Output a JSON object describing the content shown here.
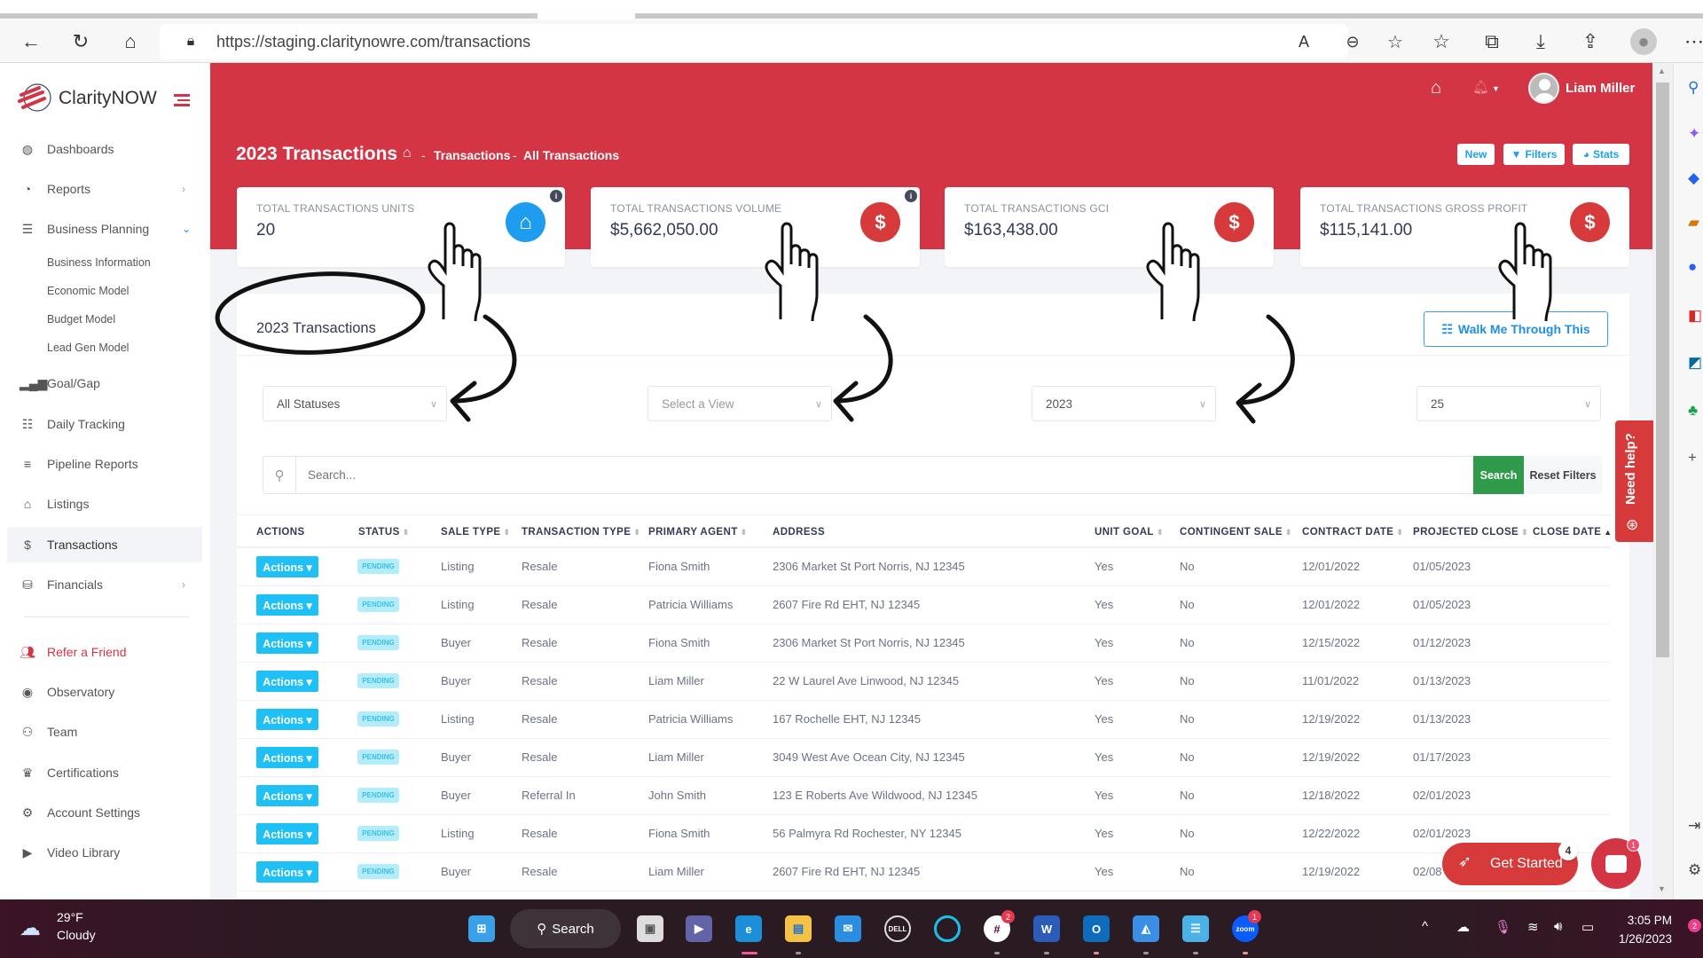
{
  "browser": {
    "url": "https://staging.claritynowre.com/transactions",
    "icons": [
      "back-icon",
      "refresh-icon",
      "home-icon",
      "lock-icon",
      "read-aloud-icon",
      "zoom-out-icon",
      "add-favorite-icon",
      "favorites-icon",
      "collections-icon",
      "downloads-icon",
      "share-icon",
      "profile-icon",
      "more-icon"
    ]
  },
  "sidebar": {
    "logo": "ClarityNOW",
    "items": [
      {
        "label": "Dashboards",
        "icon": "dashboard-icon"
      },
      {
        "label": "Reports",
        "icon": "pie-chart-icon"
      },
      {
        "label": "Business Planning",
        "icon": "list-check-icon"
      },
      {
        "label": "Business Information"
      },
      {
        "label": "Economic Model"
      },
      {
        "label": "Budget Model"
      },
      {
        "label": "Lead Gen Model"
      },
      {
        "label": "Goal/Gap",
        "icon": "bar-chart-icon"
      },
      {
        "label": "Daily Tracking",
        "icon": "list-icon"
      },
      {
        "label": "Pipeline Reports",
        "icon": "lines-icon"
      },
      {
        "label": "Listings",
        "icon": "house-icon"
      },
      {
        "label": "Transactions",
        "icon": "dollar-icon"
      },
      {
        "label": "Financials",
        "icon": "coins-icon"
      },
      {
        "label": "Refer a Friend",
        "icon": "users-icon"
      },
      {
        "label": "Observatory",
        "icon": "eye-icon"
      },
      {
        "label": "Team",
        "icon": "team-icon"
      },
      {
        "label": "Certifications",
        "icon": "crown-icon"
      },
      {
        "label": "Account Settings",
        "icon": "gear-icon"
      },
      {
        "label": "Video Library",
        "icon": "play-icon"
      }
    ]
  },
  "header": {
    "user_name": "Liam Miller",
    "page_title": "2023 Transactions",
    "breadcrumb": [
      "Transactions",
      "All Transactions"
    ],
    "buttons": {
      "new": "New",
      "filters": "Filters",
      "stats": "Stats"
    }
  },
  "cards": [
    {
      "title": "TOTAL TRANSACTIONS UNITS",
      "value": "20",
      "icon": "house-icon",
      "color": "#1e9cf0"
    },
    {
      "title": "TOTAL TRANSACTIONS VOLUME",
      "value": "$5,662,050.00",
      "icon": "dollar-icon",
      "color": "#d63a3a"
    },
    {
      "title": "TOTAL TRANSACTIONS GCI",
      "value": "$163,438.00",
      "icon": "dollar-icon",
      "color": "#d63a3a"
    },
    {
      "title": "TOTAL TRANSACTIONS GROSS PROFIT",
      "value": "$115,141.00",
      "icon": "dollar-icon",
      "color": "#d63a3a"
    }
  ],
  "panel": {
    "title": "2023 Transactions",
    "walk_me": "Walk Me Through This",
    "filters": {
      "status": "All Statuses",
      "view_placeholder": "Select a View",
      "year": "2023",
      "per_page": "25"
    },
    "search_placeholder": "Search...",
    "search_button": "Search",
    "reset_button": "Reset Filters"
  },
  "table": {
    "columns": [
      "ACTIONS",
      "STATUS",
      "SALE TYPE",
      "TRANSACTION TYPE",
      "PRIMARY AGENT",
      "ADDRESS",
      "UNIT GOAL",
      "CONTINGENT SALE",
      "CONTRACT DATE",
      "PROJECTED CLOSE",
      "CLOSE DATE"
    ],
    "sort_marks": [
      "",
      "⬍",
      "⬍",
      "⬍",
      "⬍",
      "",
      "⬍",
      "⬍",
      "⬍",
      "⬍",
      "▲"
    ],
    "action_label": "Actions ▾",
    "rows": [
      {
        "status": "PENDING",
        "sale_type": "Listing",
        "transaction_type": "Resale",
        "agent": "Fiona Smith",
        "address": "2306 Market St Port Norris, NJ 12345",
        "unit_goal": "Yes",
        "contingent": "No",
        "contract_date": "12/01/2022",
        "projected_close": "01/05/2023",
        "close_date": ""
      },
      {
        "status": "PENDING",
        "sale_type": "Listing",
        "transaction_type": "Resale",
        "agent": "Patricia Williams",
        "address": "2607 Fire Rd EHT, NJ 12345",
        "unit_goal": "Yes",
        "contingent": "No",
        "contract_date": "12/01/2022",
        "projected_close": "01/05/2023",
        "close_date": ""
      },
      {
        "status": "PENDING",
        "sale_type": "Buyer",
        "transaction_type": "Resale",
        "agent": "Fiona Smith",
        "address": "2306 Market St Port Norris, NJ 12345",
        "unit_goal": "Yes",
        "contingent": "No",
        "contract_date": "12/15/2022",
        "projected_close": "01/12/2023",
        "close_date": ""
      },
      {
        "status": "PENDING",
        "sale_type": "Buyer",
        "transaction_type": "Resale",
        "agent": "Liam Miller",
        "address": "22 W Laurel Ave Linwood, NJ 12345",
        "unit_goal": "Yes",
        "contingent": "No",
        "contract_date": "11/01/2022",
        "projected_close": "01/13/2023",
        "close_date": ""
      },
      {
        "status": "PENDING",
        "sale_type": "Listing",
        "transaction_type": "Resale",
        "agent": "Patricia Williams",
        "address": "167 Rochelle EHT, NJ 12345",
        "unit_goal": "Yes",
        "contingent": "No",
        "contract_date": "12/19/2022",
        "projected_close": "01/13/2023",
        "close_date": ""
      },
      {
        "status": "PENDING",
        "sale_type": "Buyer",
        "transaction_type": "Resale",
        "agent": "Liam Miller",
        "address": "3049 West Ave Ocean City, NJ 12345",
        "unit_goal": "Yes",
        "contingent": "No",
        "contract_date": "12/19/2022",
        "projected_close": "01/17/2023",
        "close_date": ""
      },
      {
        "status": "PENDING",
        "sale_type": "Buyer",
        "transaction_type": "Referral In",
        "agent": "John Smith",
        "address": "123 E Roberts Ave Wildwood, NJ 12345",
        "unit_goal": "Yes",
        "contingent": "No",
        "contract_date": "12/18/2022",
        "projected_close": "02/01/2023",
        "close_date": ""
      },
      {
        "status": "PENDING",
        "sale_type": "Listing",
        "transaction_type": "Resale",
        "agent": "Fiona Smith",
        "address": "56 Palmyra Rd Rochester, NY 12345",
        "unit_goal": "Yes",
        "contingent": "No",
        "contract_date": "12/22/2022",
        "projected_close": "02/01/2023",
        "close_date": ""
      },
      {
        "status": "PENDING",
        "sale_type": "Buyer",
        "transaction_type": "Resale",
        "agent": "Liam Miller",
        "address": "2607 Fire Rd EHT, NJ 12345",
        "unit_goal": "Yes",
        "contingent": "No",
        "contract_date": "12/19/2022",
        "projected_close": "02/08",
        "close_date": ""
      }
    ]
  },
  "widgets": {
    "need_help": "Need help?",
    "get_started": "Get Started",
    "get_started_count": "4",
    "chat_count": "1"
  },
  "taskbar": {
    "temperature": "29°F",
    "weather": "Cloudy",
    "search": "Search",
    "time": "3:05 PM",
    "date": "1/26/2023",
    "slack_badge": "2",
    "zoom_badge": "1",
    "notification_count": "2"
  },
  "colors": {
    "brand_red": "#d33545",
    "action_blue": "#1ec0f6",
    "search_green": "#2e9a4a",
    "pending_bg": "#b3ecfb"
  }
}
